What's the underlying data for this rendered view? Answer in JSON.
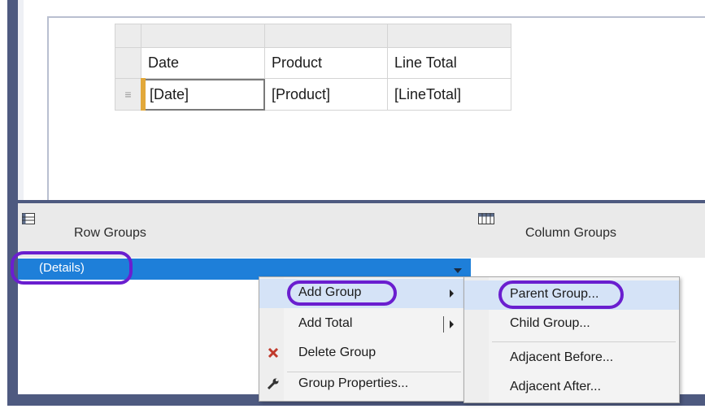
{
  "tablix": {
    "headers": [
      "Date",
      "Product",
      "Line Total"
    ],
    "row_handle_glyph": "≡",
    "detail": [
      "[Date]",
      "[Product]",
      "[LineTotal]"
    ]
  },
  "grouping_pane": {
    "row_groups_title": "Row Groups",
    "column_groups_title": "Column Groups",
    "row_groups_icon": "row-groups-icon",
    "column_groups_icon": "column-groups-icon",
    "details_label": "(Details)"
  },
  "context_menu": {
    "items": [
      {
        "label": "Add Group",
        "icon": "",
        "has_submenu": true,
        "highlighted": true
      },
      {
        "label": "Add Total",
        "icon": "",
        "has_submenu": true,
        "highlighted": false
      },
      {
        "label": "Delete Group",
        "icon": "delete-x-icon",
        "has_submenu": false,
        "highlighted": false
      },
      {
        "label": "Group Properties...",
        "icon": "wrench-icon",
        "has_submenu": false,
        "highlighted": false
      }
    ]
  },
  "submenu": {
    "items": [
      {
        "label": "Parent Group...",
        "highlighted": true
      },
      {
        "label": "Child Group...",
        "highlighted": false
      },
      {
        "label": "Adjacent Before...",
        "highlighted": false
      },
      {
        "label": "Adjacent After...",
        "highlighted": false
      }
    ]
  },
  "colors": {
    "frame": "#4e5a80",
    "selection": "#1e7fd9",
    "menu_highlight": "#d5e3f7",
    "annotation": "#6a1ecf",
    "delete_icon": "#c0392b"
  }
}
